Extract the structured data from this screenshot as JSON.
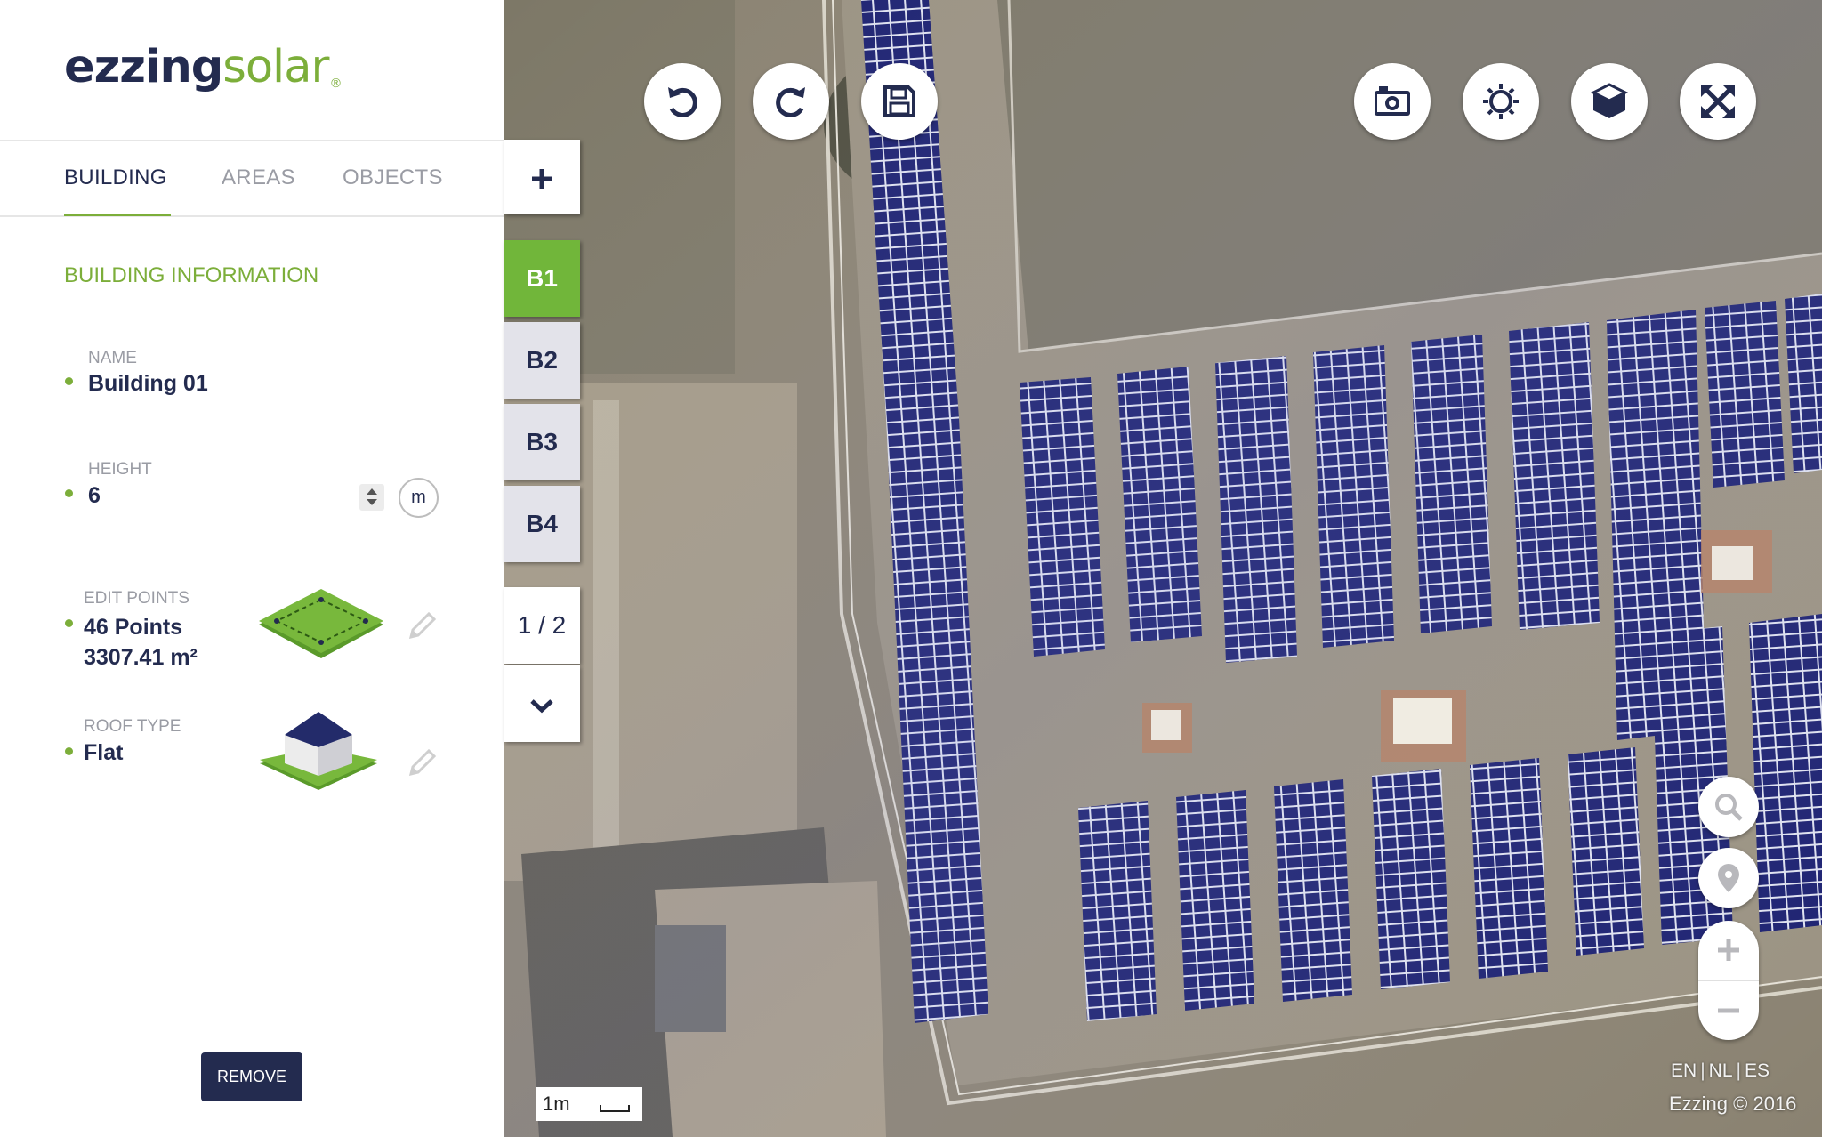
{
  "logo": {
    "part1": "ezzing",
    "part2": "solar",
    "mark": "®"
  },
  "tabs": [
    {
      "label": "BUILDING",
      "active": true
    },
    {
      "label": "AREAS",
      "active": false
    },
    {
      "label": "OBJECTS",
      "active": false
    }
  ],
  "section_title": "BUILDING INFORMATION",
  "fields": {
    "name": {
      "label": "NAME",
      "value": "Building 01"
    },
    "height": {
      "label": "HEIGHT",
      "value": "6",
      "unit": "m"
    },
    "edit_points": {
      "label": "EDIT POINTS",
      "points": "46 Points",
      "area": "3307.41 m²"
    },
    "roof_type": {
      "label": "ROOF TYPE",
      "value": "Flat"
    }
  },
  "remove_label": "REMOVE",
  "building_tabs": {
    "add_icon": "plus-icon",
    "items": [
      "B1",
      "B2",
      "B3",
      "B4"
    ],
    "active": "B1",
    "page": "1 / 2",
    "more_icon": "chevron-down-icon"
  },
  "toolbar_left": [
    "undo-icon",
    "redo-icon",
    "save-icon"
  ],
  "toolbar_right": [
    "camera-icon",
    "sun-icon",
    "cube-icon",
    "fullscreen-icon"
  ],
  "map_controls": [
    "search-icon",
    "location-pin-icon",
    "zoom-in-icon",
    "zoom-out-icon"
  ],
  "scale_label": "1m",
  "languages": [
    "EN",
    "NL",
    "ES"
  ],
  "copyright": "Ezzing © 2016",
  "colors": {
    "brand_dark": "#232b4f",
    "brand_green": "#7cae3a",
    "active_tab": "#71b63a",
    "panel": "#1a1f6e"
  }
}
